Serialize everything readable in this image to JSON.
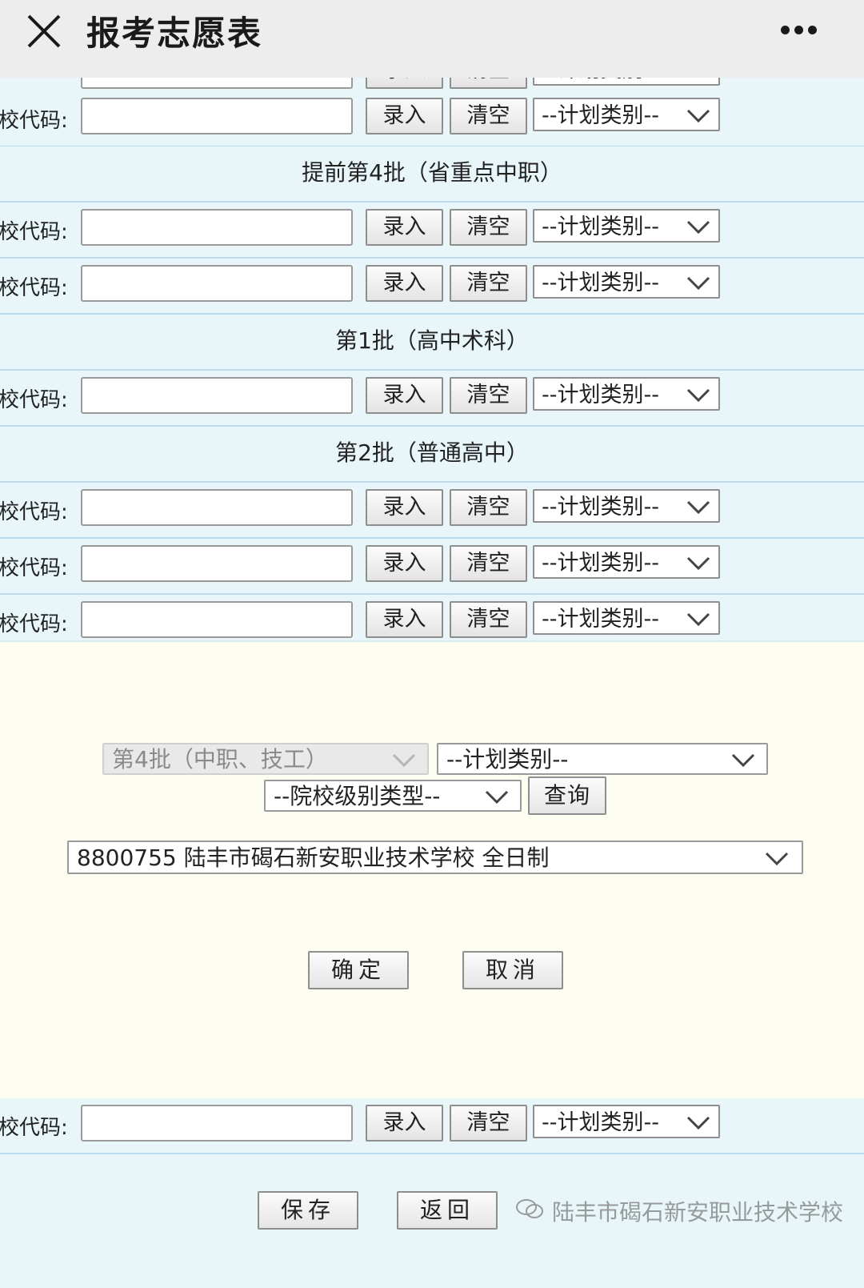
{
  "header": {
    "title": "报考志愿表",
    "close_icon": "close-icon",
    "more_icon": "more-dots-icon"
  },
  "row_common": {
    "label": "校代码:",
    "enter_label": "录入",
    "clear_label": "清空",
    "plan_select": "--计划类别--"
  },
  "sections": [
    {
      "title": "提前第4批（省重点中职）"
    },
    {
      "title": "第1批（高中术科）"
    },
    {
      "title": "第2批（普通高中）"
    }
  ],
  "modal": {
    "batch_select": "第4批（中职、技工）",
    "plan_select": "--计划类别--",
    "level_select": "--院校级别类型--",
    "query_label": "查询",
    "school_select": "8800755 陆丰市碣石新安职业技术学校 全日制",
    "confirm_label": "确定",
    "cancel_label": "取消"
  },
  "footer": {
    "save_label": "保存",
    "back_label": "返回",
    "watermark": "陆丰市碣石新安职业技术学校"
  },
  "colors": {
    "page_bg": "#eaf6fb",
    "row_border": "#b9dcef",
    "modal_bg": "#fdfdf2",
    "topbar_bg": "#ededed"
  }
}
